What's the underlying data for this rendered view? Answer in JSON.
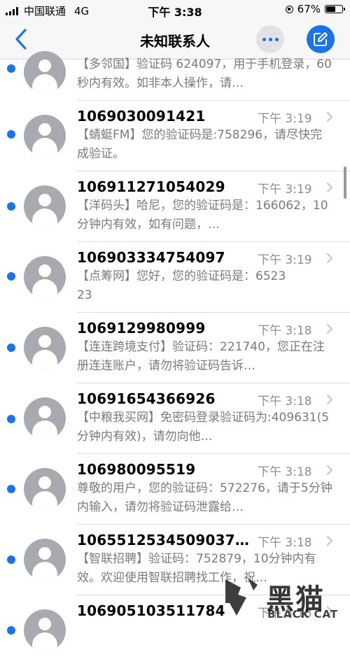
{
  "status_bar": {
    "carrier": "中国联通",
    "network": "4G",
    "time": "下午 3:38",
    "battery": "67%",
    "battery_level": 0.67
  },
  "nav": {
    "title": "未知联系人",
    "back_icon": "chevron-left-icon",
    "more_icon": "ellipsis-icon",
    "compose_icon": "compose-icon",
    "accent_color": "#1a73e8"
  },
  "messages": [
    {
      "sender": "",
      "time": "",
      "preview": "【多邻国】验证码 624097，用于手机登录，60 秒内有效。如非本人操作，请…"
    },
    {
      "sender": "1069030091421",
      "time": "下午 3:19",
      "preview": "【蜻蜓FM】您的验证码是:758296，请尽快完成验证。"
    },
    {
      "sender": "106911271054029",
      "time": "下午 3:19",
      "preview": "【洋码头】哈尼，您的验证码是：166062，10分钟内有效，如有问题，…"
    },
    {
      "sender": "106903334754097",
      "time": "下午 3:19",
      "preview": "【点筹网】您好，您的验证码是：652323"
    },
    {
      "sender": "1069129980999",
      "time": "下午 3:18",
      "preview": "【连连跨境支付】验证码：221740，您正在注册连连账户，请勿将验证码告诉…"
    },
    {
      "sender": "10691654366926",
      "time": "下午 3:18",
      "preview": "【中粮我买网】免密码登录验证码为:409631(5分钟内有效)，请勿向他…"
    },
    {
      "sender": "106980095519",
      "time": "下午 3:18",
      "preview": "尊敬的用户，您的验证码：572276，请于5分钟内输入，请勿将验证码泄露给…"
    },
    {
      "sender": "106551253450903​7…",
      "time": "下午 3:18",
      "preview": "【智联招聘】验证码：752879，10分钟内有效。欢迎使用智联招聘找工作，祝…"
    },
    {
      "sender": "106905103511784",
      "time": "下午 3:18",
      "preview": ""
    }
  ],
  "watermark": {
    "text_cn": "黑猫",
    "text_en": "BLACK CAT"
  }
}
